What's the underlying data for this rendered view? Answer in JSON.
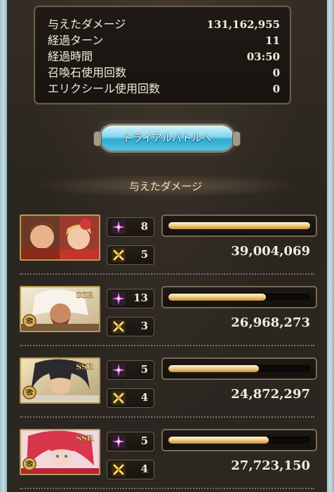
{
  "summary": {
    "rows": [
      {
        "label": "与えたダメージ",
        "value": "131,162,955"
      },
      {
        "label": "経過ターン",
        "value": "11"
      },
      {
        "label": "経過時間",
        "value": "03:50"
      },
      {
        "label": "召喚石使用回数",
        "value": "0"
      },
      {
        "label": "エリクシール使用回数",
        "value": "0"
      }
    ]
  },
  "trial_button": {
    "label": "トライアルバトルへ"
  },
  "damage_section": {
    "title": "与えたダメージ"
  },
  "characters": [
    {
      "portrait": "main-character-duo",
      "rarity": "",
      "stat1": "8",
      "stat2": "5",
      "bar_ratio": 1.0,
      "damage": "39,004,069"
    },
    {
      "portrait": "white-haired-warrior",
      "rarity": "SSR",
      "stat1": "13",
      "stat2": "3",
      "bar_ratio": 0.69,
      "damage": "26,968,273"
    },
    {
      "portrait": "dark-haired-swordsman",
      "rarity": "SSR",
      "stat1": "5",
      "stat2": "4",
      "bar_ratio": 0.64,
      "damage": "24,872,297"
    },
    {
      "portrait": "red-haired-girl",
      "rarity": "SSR",
      "stat1": "5",
      "stat2": "4",
      "bar_ratio": 0.71,
      "damage": "27,723,150"
    }
  ],
  "icons": {
    "stat1": "pink-sparkle-icon",
    "stat2": "gold-crossed-swords-icon",
    "element": "wind-element-icon"
  },
  "colors": {
    "accent_gold": "#f1cf8a",
    "button_cyan": "#55c3e3",
    "panel_border": "#6a5c48"
  }
}
